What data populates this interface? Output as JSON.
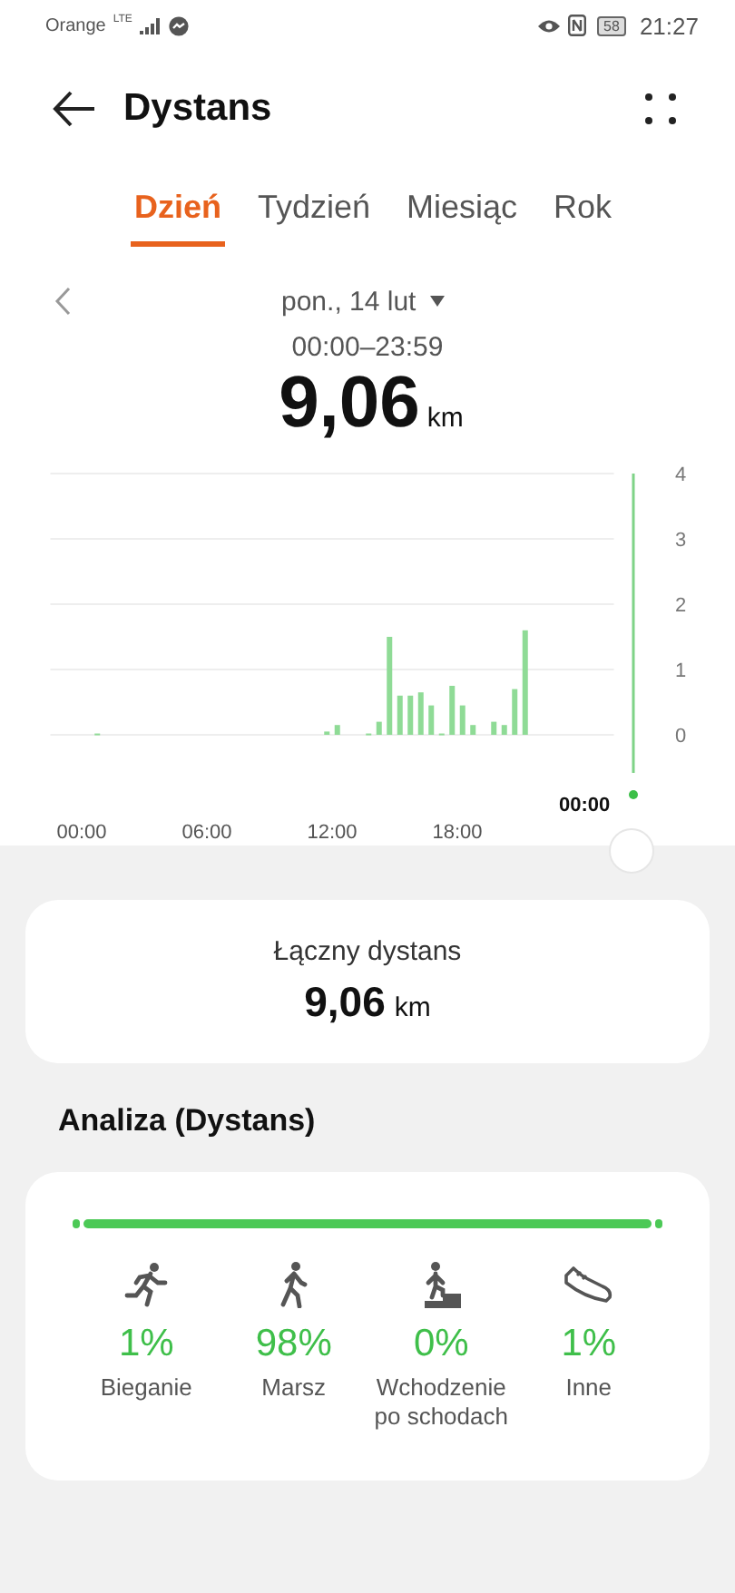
{
  "status_bar": {
    "carrier": "Orange",
    "network": "LTE",
    "battery": "58",
    "time": "21:27"
  },
  "header": {
    "title": "Dystans"
  },
  "tabs": [
    {
      "label": "Dzień",
      "selected": true
    },
    {
      "label": "Tydzień",
      "selected": false
    },
    {
      "label": "Miesiąc",
      "selected": false
    },
    {
      "label": "Rok",
      "selected": false
    }
  ],
  "date": {
    "label": "pon., 14 lut",
    "range": "00:00–23:59",
    "value": "9,06",
    "unit": "km"
  },
  "chart": {
    "cursor_label": "00:00",
    "chart_data": {
      "type": "bar",
      "x": [
        0.75,
        11.75,
        12.25,
        13.75,
        14.25,
        14.75,
        15.25,
        15.75,
        16.25,
        16.75,
        17.25,
        17.75,
        18.25,
        18.75,
        19.75,
        20.25,
        20.75,
        21.25
      ],
      "values": [
        0.02,
        0.05,
        0.15,
        0.02,
        0.2,
        1.5,
        0.6,
        0.6,
        0.65,
        0.45,
        0.02,
        0.75,
        0.45,
        0.15,
        0.2,
        0.15,
        0.7,
        1.6
      ],
      "xlim": [
        -1.5,
        25.5
      ],
      "ylim": [
        0,
        4
      ],
      "grid": true,
      "xticks": [
        {
          "value": 0,
          "label": "00:00"
        },
        {
          "value": 6,
          "label": "06:00"
        },
        {
          "value": 12,
          "label": "12:00"
        },
        {
          "value": 18,
          "label": "18:00"
        }
      ],
      "yticks": [
        0,
        1,
        2,
        3,
        4
      ]
    }
  },
  "total": {
    "label": "Łączny dystans",
    "value": "9,06",
    "unit": "km"
  },
  "analysis": {
    "title": "Analiza (Dystans)",
    "activities": [
      {
        "kind": "running",
        "percent": "1%",
        "label": "Bieganie"
      },
      {
        "kind": "walking",
        "percent": "98%",
        "label": "Marsz"
      },
      {
        "kind": "stairs",
        "percent": "0%",
        "label": "Wchodzenie po schodach"
      },
      {
        "kind": "other",
        "percent": "1%",
        "label": "Inne"
      }
    ]
  }
}
